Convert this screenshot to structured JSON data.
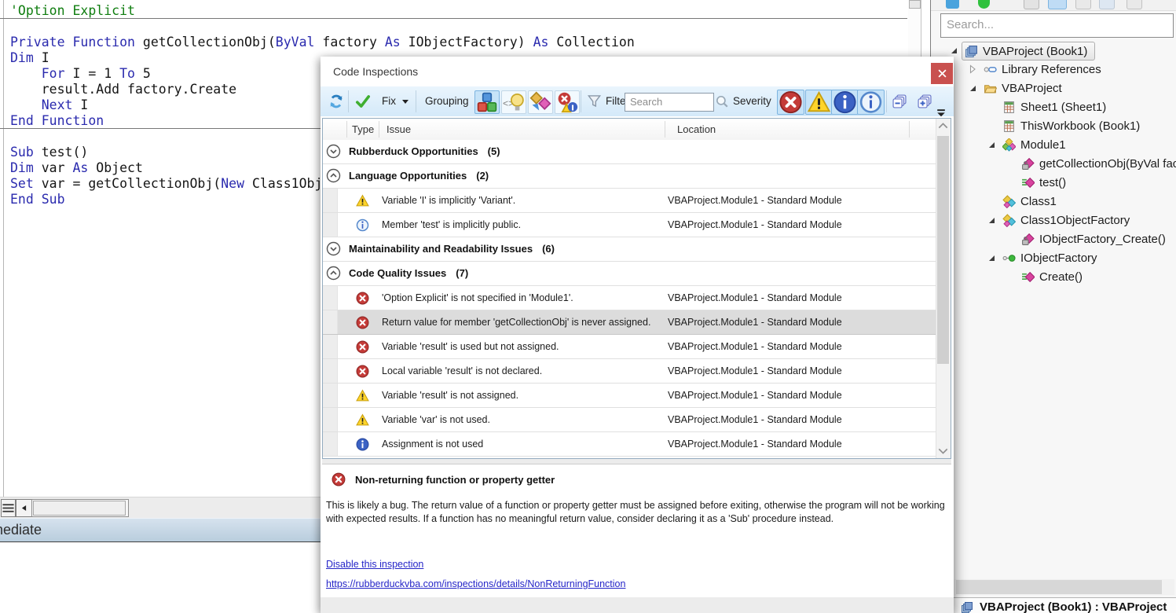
{
  "editor": {
    "immediate_title": "Immediate",
    "lines": [
      {
        "segs": [
          {
            "t": "'Option Explicit",
            "s": "c"
          }
        ],
        "sep": true
      },
      {
        "segs": []
      },
      {
        "segs": [
          {
            "t": "Private",
            "s": "k"
          },
          {
            "t": " "
          },
          {
            "t": "Function",
            "s": "k"
          },
          {
            "t": " getCollectionObj("
          },
          {
            "t": "ByVal",
            "s": "k"
          },
          {
            "t": " factory "
          },
          {
            "t": "As",
            "s": "k"
          },
          {
            "t": " IObjectFactory) "
          },
          {
            "t": "As",
            "s": "k"
          },
          {
            "t": " Collection"
          }
        ]
      },
      {
        "segs": [
          {
            "t": "Dim",
            "s": "k"
          },
          {
            "t": " I"
          }
        ]
      },
      {
        "segs": [
          {
            "t": "    "
          },
          {
            "t": "For",
            "s": "k"
          },
          {
            "t": " I = 1 "
          },
          {
            "t": "To",
            "s": "k"
          },
          {
            "t": " 5"
          }
        ]
      },
      {
        "segs": [
          {
            "t": "    result.Add factory.Create"
          }
        ]
      },
      {
        "segs": [
          {
            "t": "    "
          },
          {
            "t": "Next",
            "s": "k"
          },
          {
            "t": " I"
          }
        ]
      },
      {
        "segs": [
          {
            "t": "End Function",
            "s": "k"
          }
        ],
        "sep": true
      },
      {
        "segs": []
      },
      {
        "segs": [
          {
            "t": "Sub",
            "s": "k"
          },
          {
            "t": " test()"
          }
        ]
      },
      {
        "segs": [
          {
            "t": "Dim",
            "s": "k"
          },
          {
            "t": " var "
          },
          {
            "t": "As",
            "s": "k"
          },
          {
            "t": " Object"
          }
        ]
      },
      {
        "segs": [
          {
            "t": "Set",
            "s": "k"
          },
          {
            "t": " var = getCollectionObj("
          },
          {
            "t": "New",
            "s": "k"
          },
          {
            "t": " Class1Obj"
          }
        ]
      },
      {
        "segs": [
          {
            "t": "End Sub",
            "s": "k"
          }
        ]
      }
    ]
  },
  "inspections_dialog": {
    "title": "Code Inspections",
    "toolbar": {
      "fix_label": "Fix",
      "grouping_label": "Grouping",
      "filter_label": "Filter",
      "search_placeholder": "Search",
      "severity_label": "Severity"
    },
    "columns": [
      "Type",
      "Issue",
      "Location"
    ],
    "rows": [
      {
        "kind": "group",
        "label": "Rubberduck Opportunities",
        "count": "(5)",
        "expanded": false
      },
      {
        "kind": "group",
        "label": "Language Opportunities",
        "count": "(2)",
        "expanded": true
      },
      {
        "kind": "item",
        "severity": "warning",
        "issue": "Variable 'I' is implicitly 'Variant'.",
        "location": "VBAProject.Module1 - Standard Module"
      },
      {
        "kind": "item",
        "severity": "info-outline",
        "issue": "Member 'test' is implicitly public.",
        "location": "VBAProject.Module1 - Standard Module"
      },
      {
        "kind": "group",
        "label": "Maintainability and Readability Issues",
        "count": "(6)",
        "expanded": false
      },
      {
        "kind": "group",
        "label": "Code Quality Issues",
        "count": "(7)",
        "expanded": true
      },
      {
        "kind": "item",
        "severity": "error",
        "issue": "'Option Explicit' is not specified in 'Module1'.",
        "location": "VBAProject.Module1 - Standard Module"
      },
      {
        "kind": "item",
        "severity": "error",
        "issue": "Return value for member 'getCollectionObj' is never assigned.",
        "location": "VBAProject.Module1 - Standard Module",
        "selected": true
      },
      {
        "kind": "item",
        "severity": "error",
        "issue": "Variable 'result' is used but not assigned.",
        "location": "VBAProject.Module1 - Standard Module"
      },
      {
        "kind": "item",
        "severity": "error",
        "issue": "Local variable 'result' is not declared.",
        "location": "VBAProject.Module1 - Standard Module"
      },
      {
        "kind": "item",
        "severity": "warning",
        "issue": "Variable 'result' is not assigned.",
        "location": "VBAProject.Module1 - Standard Module"
      },
      {
        "kind": "item",
        "severity": "warning",
        "issue": "Variable 'var' is not used.",
        "location": "VBAProject.Module1 - Standard Module"
      },
      {
        "kind": "item",
        "severity": "info",
        "issue": "Assignment is not used",
        "location": "VBAProject.Module1 - Standard Module"
      }
    ],
    "details": {
      "severity": "error",
      "title": "Non-returning function or property getter",
      "description": "This is likely a bug. The return value of a function or property getter must be assigned before exiting, otherwise the program will not be working with expected results. If a function has no meaningful return value, consider declaring it as a 'Sub' procedure instead.",
      "disable_link": "Disable this inspection",
      "url_link": "https://rubberduckvba.com/inspections/details/NonReturningFunction"
    }
  },
  "code_explorer": {
    "search_placeholder": "Search...",
    "tree": [
      {
        "label": "VBAProject (Book1)",
        "icon": "project",
        "level": 0,
        "expander": "expanded",
        "selected": true
      },
      {
        "label": "Library References",
        "icon": "library-references",
        "level": 1,
        "expander": "collapsed"
      },
      {
        "label": "VBAProject",
        "icon": "folder",
        "level": 1,
        "expander": "expanded"
      },
      {
        "label": "Sheet1 (Sheet1)",
        "icon": "worksheet",
        "level": 2
      },
      {
        "label": "ThisWorkbook (Book1)",
        "icon": "worksheet",
        "level": 2
      },
      {
        "label": "Module1",
        "icon": "module",
        "level": 2,
        "expander": "expanded"
      },
      {
        "label": "getCollectionObj(ByVal fact",
        "icon": "private-method",
        "level": 3
      },
      {
        "label": "test()",
        "icon": "public-method",
        "level": 3
      },
      {
        "label": "Class1",
        "icon": "class",
        "level": 2
      },
      {
        "label": "Class1ObjectFactory",
        "icon": "class",
        "level": 2,
        "expander": "expanded"
      },
      {
        "label": "IObjectFactory_Create()",
        "icon": "private-method",
        "level": 3
      },
      {
        "label": "IObjectFactory",
        "icon": "interface",
        "level": 2,
        "expander": "expanded"
      },
      {
        "label": "Create()",
        "icon": "public-method",
        "level": 3
      }
    ],
    "status_text": "VBAProject (Book1) : VBAProject"
  },
  "colors": {
    "keyword_blue": "#2a2aae",
    "comment_green": "#0f7d0f",
    "toolbar_blue": "#d4e9f9",
    "pressed_blue": "#c6e3f8",
    "close_red": "#c9514f",
    "error_red": "#c43b38",
    "warning_yellow": "#ffd42a",
    "info_blue": "#3b62c4",
    "selection_gray": "#dcdcdc",
    "immediate_bar": "#c3d5e4"
  }
}
